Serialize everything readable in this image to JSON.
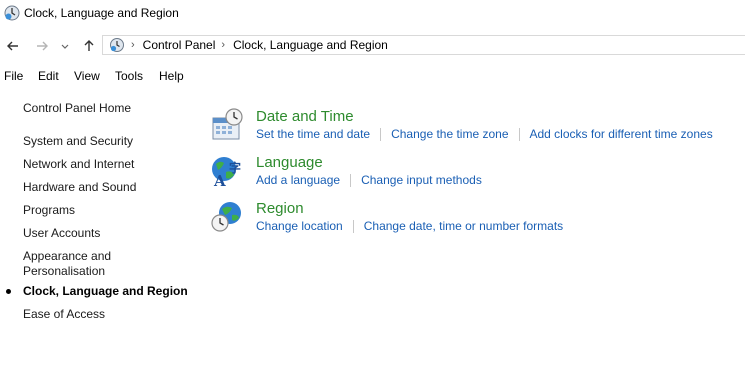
{
  "window": {
    "title": "Clock, Language and Region"
  },
  "navigation": {
    "back_icon": "arrow-left-icon",
    "forward_icon": "arrow-right-icon",
    "recent_icon": "chevron-down-icon",
    "up_icon": "arrow-up-icon"
  },
  "address_bar": {
    "crumbs": [
      "Control Panel",
      "Clock, Language and Region"
    ]
  },
  "menu": [
    "File",
    "Edit",
    "View",
    "Tools",
    "Help"
  ],
  "sidebar": {
    "home": "Control Panel Home",
    "items": [
      "System and Security",
      "Network and Internet",
      "Hardware and Sound",
      "Programs",
      "User Accounts",
      "Appearance and Personalisation",
      "Clock, Language and Region",
      "Ease of Access"
    ],
    "current_index": 6
  },
  "categories": [
    {
      "title": "Date and Time",
      "icon": "calendar-clock-icon",
      "links": [
        "Set the time and date",
        "Change the time zone",
        "Add clocks for different time zones"
      ]
    },
    {
      "title": "Language",
      "icon": "globe-language-icon",
      "links": [
        "Add a language",
        "Change input methods"
      ]
    },
    {
      "title": "Region",
      "icon": "globe-clock-icon",
      "links": [
        "Change location",
        "Change date, time or number formats"
      ]
    }
  ],
  "colors": {
    "category_title": "#2e8b2e",
    "link": "#1a5fb4"
  }
}
